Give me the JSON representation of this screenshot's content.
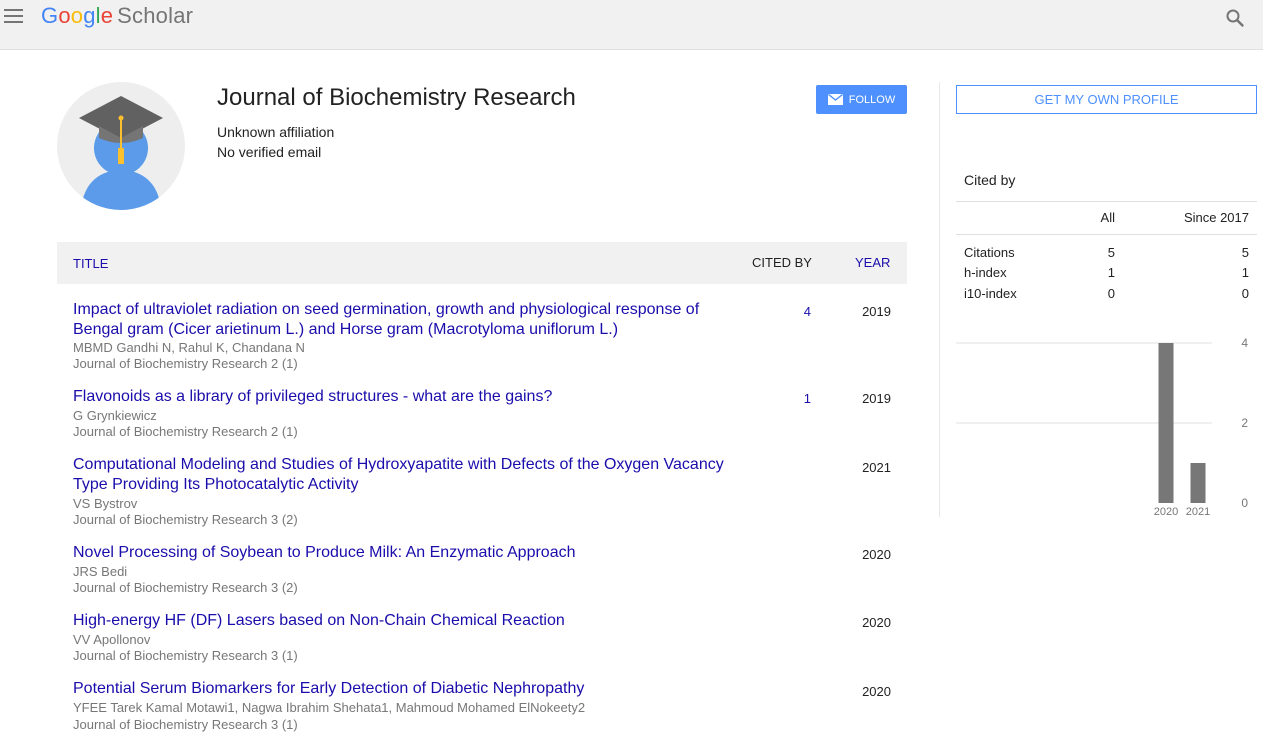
{
  "header": {
    "logo_letters": [
      "G",
      "o",
      "o",
      "g",
      "l",
      "e"
    ],
    "logo_product": "Scholar"
  },
  "profile": {
    "name": "Journal of Biochemistry Research",
    "affiliation": "Unknown affiliation",
    "email": "No verified email",
    "follow_label": "FOLLOW"
  },
  "table": {
    "col_title": "TITLE",
    "col_cited": "CITED BY",
    "col_year": "YEAR",
    "rows": [
      {
        "title": "Impact of ultraviolet radiation on seed germination, growth and physiological response of Bengal gram (Cicer arietinum L.) and Horse gram (Macrotyloma uniflorum L.)",
        "authors": "MBMD Gandhi N, Rahul K, Chandana N",
        "venue": "Journal of Biochemistry Research 2 (1)",
        "cited": "4",
        "year": "2019"
      },
      {
        "title": "Flavonoids as a library of privileged structures - what are the gains?",
        "authors": "G Grynkiewicz",
        "venue": "Journal of Biochemistry Research 2 (1)",
        "cited": "1",
        "year": "2019"
      },
      {
        "title": "Computational Modeling and Studies of Hydroxyapatite with Defects of the Oxygen Vacancy Type Providing Its Photocatalytic Activity",
        "authors": "VS Bystrov",
        "venue": "Journal of Biochemistry Research 3 (2)",
        "cited": "",
        "year": "2021"
      },
      {
        "title": "Novel Processing of Soybean to Produce Milk: An Enzymatic Approach",
        "authors": "JRS Bedi",
        "venue": "Journal of Biochemistry Research 3 (2)",
        "cited": "",
        "year": "2020"
      },
      {
        "title": "High-energy HF (DF) Lasers based on Non-Chain Chemical Reaction",
        "authors": "VV Apollonov",
        "venue": "Journal of Biochemistry Research 3 (1)",
        "cited": "",
        "year": "2020"
      },
      {
        "title": "Potential Serum Biomarkers for Early Detection of Diabetic Nephropathy",
        "authors": "YFEE Tarek Kamal Motawi1, Nagwa Ibrahim Shehata1, Mahmoud Mohamed ElNokeety2",
        "venue": "Journal of Biochemistry Research 3 (1)",
        "cited": "",
        "year": "2020"
      }
    ]
  },
  "sidebar": {
    "get_profile_label": "GET MY OWN PROFILE",
    "cited_by_title": "Cited by",
    "stats_header": {
      "all": "All",
      "since": "Since 2017"
    },
    "stats": [
      {
        "label": "Citations",
        "all": "5",
        "since": "5"
      },
      {
        "label": "h-index",
        "all": "1",
        "since": "1"
      },
      {
        "label": "i10-index",
        "all": "0",
        "since": "0"
      }
    ]
  },
  "chart_data": {
    "type": "bar",
    "categories": [
      "2020",
      "2021"
    ],
    "values": [
      4,
      1
    ],
    "ylim": [
      0,
      4
    ],
    "yticks": [
      "4",
      "2",
      "0"
    ],
    "grid": true,
    "bar_color": "#777777"
  }
}
